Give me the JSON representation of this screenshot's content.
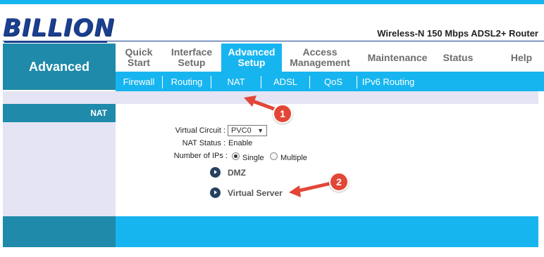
{
  "brand": {
    "logo": "BILLION",
    "product": "Wireless-N 150 Mbps ADSL2+ Router"
  },
  "left_title": "Advanced",
  "main_nav": [
    {
      "label": "Quick\nStart",
      "active": false
    },
    {
      "label": "Interface\nSetup",
      "active": false
    },
    {
      "label": "Advanced\nSetup",
      "active": true
    },
    {
      "label": "Access\nManagement",
      "active": false
    },
    {
      "label": "Maintenance",
      "active": false
    },
    {
      "label": "Status",
      "active": false
    },
    {
      "label": "Help",
      "active": false
    }
  ],
  "sub_nav": [
    "Firewall",
    "Routing",
    "NAT",
    "ADSL",
    "QoS",
    "IPv6 Routing"
  ],
  "section_label": "NAT",
  "form": {
    "virtual_circuit_label": "Virtual Circuit :",
    "virtual_circuit_value": "PVC0",
    "nat_status_label": "NAT Status :",
    "nat_status_value": "Enable",
    "num_ips_label": "Number of IPs :",
    "num_ips_options": [
      "Single",
      "Multiple"
    ],
    "num_ips_selected": "Single"
  },
  "links": {
    "dmz": "DMZ",
    "virtual_server": "Virtual Server"
  },
  "callouts": [
    "1",
    "2"
  ],
  "colors": {
    "accent": "#17b5ef",
    "dark_teal": "#1f8aaa",
    "lavender": "#e4e4f4",
    "callout": "#e24637",
    "logo": "#1b3f8f"
  }
}
